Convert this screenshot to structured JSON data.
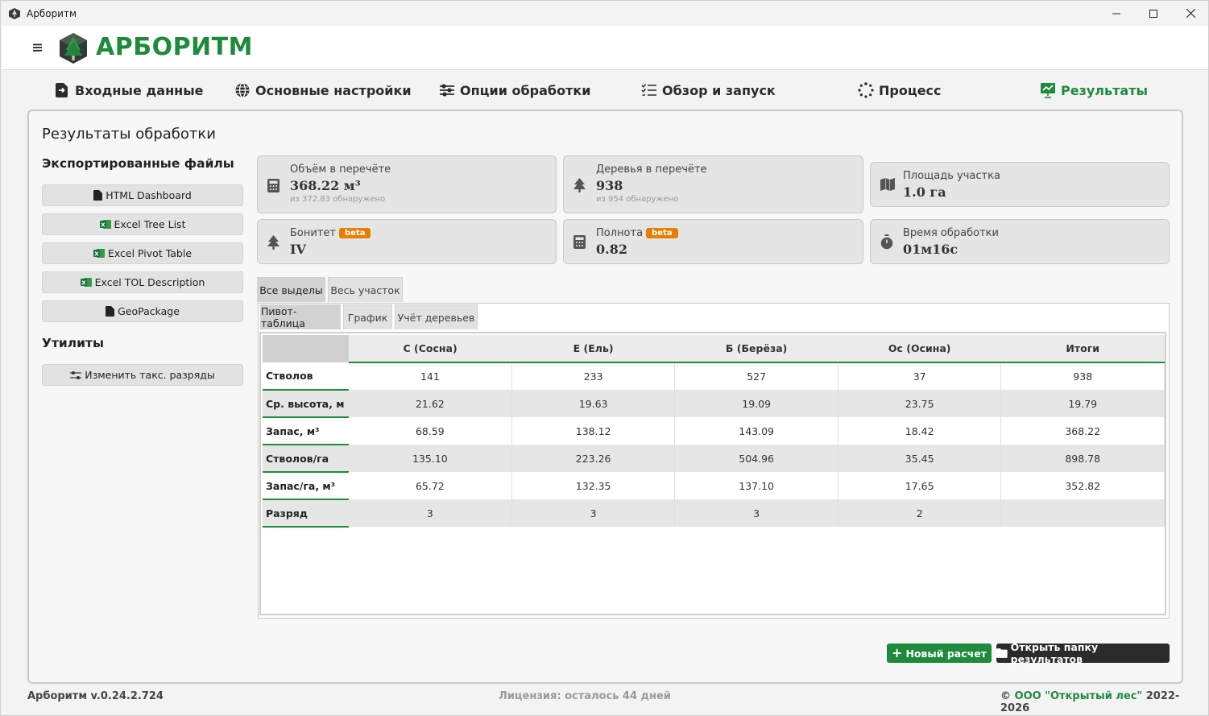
{
  "window": {
    "title": "Арборитм",
    "icon": "tree-cube-icon",
    "controls": [
      "minimize-icon",
      "maximize-icon",
      "close-icon"
    ]
  },
  "header": {
    "brand": "АРБОРИТМ",
    "menu_icon": "hamburger-icon",
    "logo": "tree-cube-logo",
    "brand_color": "#1e8a3c"
  },
  "nav": {
    "items": [
      {
        "label": "Входные данные",
        "icon": "file-import-icon"
      },
      {
        "label": "Основные настройки",
        "icon": "globe-icon"
      },
      {
        "label": "Опции обработки",
        "icon": "sliders-icon"
      },
      {
        "label": "Обзор и запуск",
        "icon": "checklist-icon"
      },
      {
        "label": "Процесс",
        "icon": "spinner-icon"
      },
      {
        "label": "Результаты",
        "icon": "chart-board-icon",
        "active": true
      }
    ]
  },
  "main": {
    "title": "Результаты обработки",
    "exports": {
      "title": "Экспортированные файлы",
      "buttons": [
        {
          "label": "HTML Dashboard",
          "icon": "file-icon"
        },
        {
          "label": "Excel Tree List",
          "icon": "excel-icon"
        },
        {
          "label": "Excel Pivot Table",
          "icon": "excel-icon"
        },
        {
          "label": "Excel TOL Description",
          "icon": "excel-icon"
        },
        {
          "label": "GeoPackage",
          "icon": "file-icon"
        }
      ]
    },
    "utilities": {
      "title": "Утилиты",
      "buttons": [
        {
          "label": "Изменить такс. разряды",
          "icon": "sliders-icon"
        }
      ]
    },
    "cards": [
      {
        "label": "Объём в перечёте",
        "value": "368.22 м³",
        "sub": "из 372.83 обнаружено",
        "icon": "calculator-icon"
      },
      {
        "label": "Деревья в перечёте",
        "value": "938",
        "sub": "из 954 обнаружено",
        "icon": "tree-icon"
      },
      {
        "label": "Площадь участка",
        "value": "1.0 га",
        "icon": "map-icon"
      },
      {
        "label": "Бонитет",
        "value": "IV",
        "badge": "beta",
        "icon": "tree-icon"
      },
      {
        "label": "Полнота",
        "value": "0.82",
        "badge": "beta",
        "icon": "calculator-icon"
      },
      {
        "label": "Время обработки",
        "value": "01м16с",
        "icon": "stopwatch-icon"
      }
    ],
    "tabs_outer": [
      {
        "label": "Все выделы",
        "active": true
      },
      {
        "label": "Весь участок",
        "active": false
      }
    ],
    "tabs_inner": [
      {
        "label": "Пивот-таблица",
        "active": true
      },
      {
        "label": "График",
        "active": false
      },
      {
        "label": "Учёт деревьев",
        "active": false
      }
    ],
    "table": {
      "columns": [
        "С (Сосна)",
        "Е (Ель)",
        "Б (Берёза)",
        "Ос (Осина)",
        "Итоги"
      ],
      "rows": [
        {
          "header": "Стволов",
          "values": [
            "141",
            "233",
            "527",
            "37",
            "938"
          ]
        },
        {
          "header": "Ср. высота, м",
          "values": [
            "21.62",
            "19.63",
            "19.09",
            "23.75",
            "19.79"
          ]
        },
        {
          "header": "Запас, м³",
          "values": [
            "68.59",
            "138.12",
            "143.09",
            "18.42",
            "368.22"
          ]
        },
        {
          "header": "Стволов/га",
          "values": [
            "135.10",
            "223.26",
            "504.96",
            "35.45",
            "898.78"
          ]
        },
        {
          "header": "Запас/га, м³",
          "values": [
            "65.72",
            "132.35",
            "137.10",
            "17.65",
            "352.82"
          ]
        },
        {
          "header": "Разряд",
          "values": [
            "3",
            "3",
            "3",
            "2",
            ""
          ]
        }
      ]
    },
    "actions": {
      "new_calc": "Новый расчет",
      "open_folder": "Открыть папку результатов",
      "new_color": "#1e8a3c",
      "open_color": "#2b2b2b"
    }
  },
  "footer": {
    "version": "Арборитм v.0.24.2.724",
    "license": "Лицензия: осталось 44 дней",
    "copyright_prefix": "©",
    "company": "ООО \"Открытый лес\"",
    "years": "2022-2026"
  }
}
